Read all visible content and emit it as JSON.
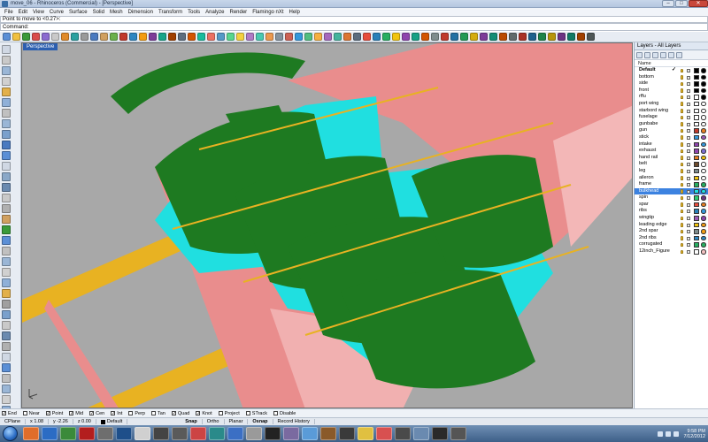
{
  "window": {
    "title": "move_06 - Rhinoceros (Commercial) - [Perspective]",
    "buttons": [
      "–",
      "□",
      "✕"
    ]
  },
  "menubar": [
    "File",
    "Edit",
    "View",
    "Curve",
    "Surface",
    "Solid",
    "Mesh",
    "Dimension",
    "Transform",
    "Tools",
    "Analyze",
    "Render",
    "Flamingo nXt",
    "Help"
  ],
  "command": {
    "history": "Point to move to <0.27>:",
    "label": "Command:",
    "value": ""
  },
  "viewport": {
    "label": "Perspective"
  },
  "colors": {
    "viewport_bg": "#a8a8a8",
    "green": "#1e7a21",
    "cyan": "#20dfe0",
    "pink": "#e98d8d",
    "orange": "#e8b222",
    "selected": "#3c82e0"
  },
  "layers": {
    "header": "Layers - All Layers",
    "column_name": "Name",
    "rows": [
      {
        "name": "Default",
        "check": "✓",
        "color": "#000000",
        "mat": "#000000",
        "bold": true
      },
      {
        "name": "bottom",
        "color": "#000000",
        "mat": "#000000"
      },
      {
        "name": "side",
        "color": "#000000",
        "mat": "#000000"
      },
      {
        "name": "front",
        "color": "#000000",
        "mat": "#000000"
      },
      {
        "name": "rffu",
        "color": "#ffffff",
        "mat": "#000000"
      },
      {
        "name": "port wing",
        "color": "#ffffff",
        "mat": "#ffffff"
      },
      {
        "name": "starbord wing",
        "color": "#ffffff",
        "mat": "#ffffff"
      },
      {
        "name": "fuselage",
        "color": "#ffffff",
        "mat": "#ffffff"
      },
      {
        "name": "gunbabe",
        "color": "#ffffff",
        "mat": "#ffffff"
      },
      {
        "name": "gun",
        "color": "#c0392b",
        "mat": "#e67e22"
      },
      {
        "name": "stick",
        "color": "#3498db",
        "mat": "#9b59b6"
      },
      {
        "name": "intake",
        "color": "#8e44ad",
        "mat": "#3498db"
      },
      {
        "name": "exhaust",
        "color": "#8e44ad",
        "mat": "#7b6fd1"
      },
      {
        "name": "hand rail",
        "color": "#e67e22",
        "mat": "#f1c40f"
      },
      {
        "name": "belt",
        "color": "#6b4a2b",
        "mat": "#ffffff"
      },
      {
        "name": "leg",
        "color": "#7f8c8d",
        "mat": "#ffffff"
      },
      {
        "name": "aileron",
        "color": "#f1c40f",
        "mat": "#ffffff"
      },
      {
        "name": "frame",
        "color": "#27ae60",
        "mat": "#27ae60"
      },
      {
        "name": "bulkhead",
        "color": "#20dfe0",
        "mat": "#20dfe0",
        "selected": true
      },
      {
        "name": "spin",
        "color": "#2ecc71",
        "mat": "#6c3483"
      },
      {
        "name": "spar",
        "color": "#e74c3c",
        "mat": "#e67e22"
      },
      {
        "name": "ribs",
        "color": "#2980b9",
        "mat": "#3498db"
      },
      {
        "name": "wingtip",
        "color": "#9b59b6",
        "mat": "#8e44ad"
      },
      {
        "name": "leading edge",
        "color": "#f1c40f",
        "mat": "#f39c12"
      },
      {
        "name": "2nd spar",
        "color": "#7f8c8d",
        "mat": "#f39c12"
      },
      {
        "name": "2nd ribs",
        "color": "#2e86c1",
        "mat": "#2e86c1"
      },
      {
        "name": "corrugated",
        "color": "#27ae60",
        "mat": "#27ae60"
      },
      {
        "name": "12inch_Figure",
        "color": "#ffffff",
        "mat": "#f2c0c0"
      }
    ]
  },
  "osnap": [
    {
      "label": "End",
      "checked": true
    },
    {
      "label": "Near",
      "checked": false
    },
    {
      "label": "Point",
      "checked": true
    },
    {
      "label": "Mid",
      "checked": true
    },
    {
      "label": "Cen",
      "checked": true
    },
    {
      "label": "Int",
      "checked": true
    },
    {
      "label": "Perp",
      "checked": false
    },
    {
      "label": "Tan",
      "checked": false
    },
    {
      "label": "Quad",
      "checked": true
    },
    {
      "label": "Knot",
      "checked": true
    },
    {
      "label": "Project",
      "checked": false
    },
    {
      "label": "STrack",
      "checked": false
    },
    {
      "label": "Disable",
      "checked": false
    }
  ],
  "status": {
    "cplane": "CPlane",
    "x": "x 1.08",
    "y": "y -2.26",
    "z": "z 0.00",
    "layer": "Default",
    "toggles": [
      "Snap",
      "Ortho",
      "Planar",
      "Osnap",
      "Record History"
    ]
  },
  "taskbar": {
    "time": "9:58 PM",
    "date": "7/12/2012",
    "apps": [
      "#e06d2a",
      "#2b6cc4",
      "#3b8a3a",
      "#b31e1e",
      "#6e6e6e",
      "#1e4f8a",
      "#d0d0d0",
      "#444444",
      "#5a5a5a",
      "#c44",
      "#2a8a8a",
      "#3b6fc4",
      "#9a9a9a",
      "#222",
      "#7a6aa0",
      "#5a9bd8",
      "#8a5a2a",
      "#3a3a3a",
      "#e0c040",
      "#d85050",
      "#4a4a4a",
      "#6a8ab0",
      "#2a2a2a",
      "#555"
    ]
  }
}
